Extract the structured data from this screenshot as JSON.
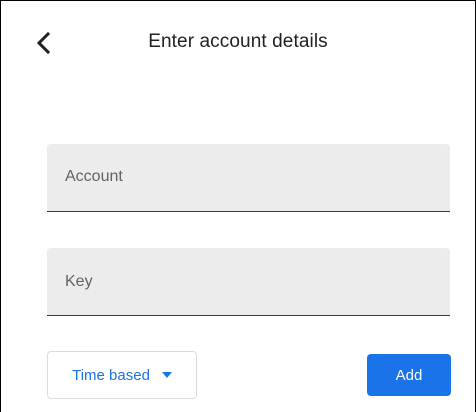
{
  "header": {
    "title": "Enter account details",
    "back_icon": "chevron-left-icon"
  },
  "form": {
    "account": {
      "placeholder": "Account",
      "value": ""
    },
    "key": {
      "placeholder": "Key",
      "value": ""
    },
    "type_select": {
      "selected": "Time based",
      "icon": "caret-down-icon"
    },
    "add_label": "Add"
  },
  "colors": {
    "accent": "#1a73e8",
    "field_background": "#ececec",
    "text_primary": "#202124"
  }
}
